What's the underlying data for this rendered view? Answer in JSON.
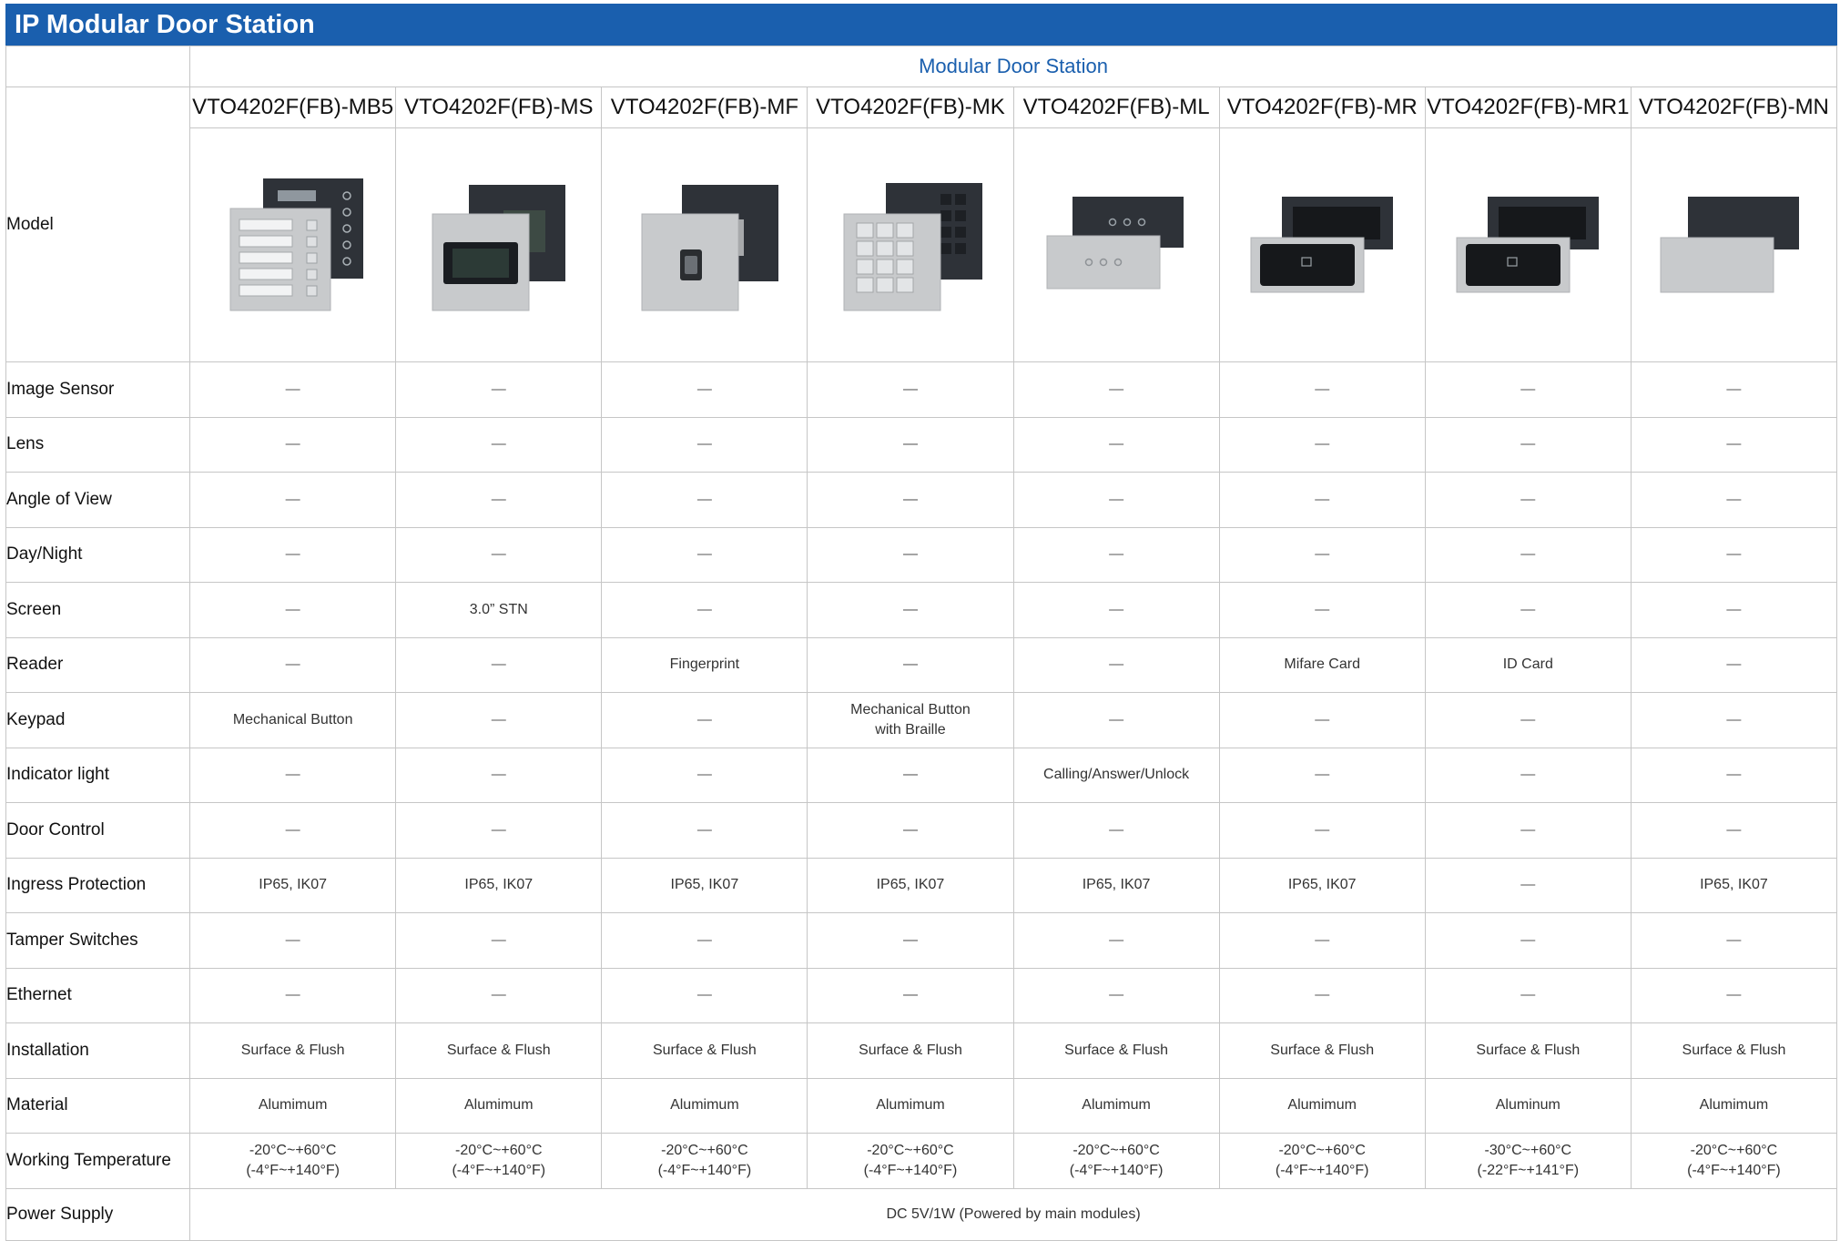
{
  "page_title": "IP Modular Door Station",
  "group_header": "Modular Door Station",
  "model_label": "Model",
  "models": [
    {
      "name": "VTO4202F(FB)-MB5",
      "image": "button-module-device-icon"
    },
    {
      "name": "VTO4202F(FB)-MS",
      "image": "screen-module-device-icon"
    },
    {
      "name": "VTO4202F(FB)-MF",
      "image": "fingerprint-module-device-icon"
    },
    {
      "name": "VTO4202F(FB)-MK",
      "image": "keypad-module-device-icon"
    },
    {
      "name": "VTO4202F(FB)-ML",
      "image": "indicator-module-device-icon"
    },
    {
      "name": "VTO4202F(FB)-MR",
      "image": "card-reader-module-device-icon"
    },
    {
      "name": "VTO4202F(FB)-MR1",
      "image": "id-card-reader-module-device-icon"
    },
    {
      "name": "VTO4202F(FB)-MN",
      "image": "blank-module-device-icon"
    }
  ],
  "rows": [
    {
      "label": "Image Sensor",
      "values": [
        "—",
        "—",
        "—",
        "—",
        "—",
        "—",
        "—",
        "—"
      ]
    },
    {
      "label": "Lens",
      "values": [
        "—",
        "—",
        "—",
        "—",
        "—",
        "—",
        "—",
        "—"
      ]
    },
    {
      "label": "Angle of View",
      "values": [
        "—",
        "—",
        "—",
        "—",
        "—",
        "—",
        "—",
        "—"
      ]
    },
    {
      "label": "Day/Night",
      "values": [
        "—",
        "—",
        "—",
        "—",
        "—",
        "—",
        "—",
        "—"
      ]
    },
    {
      "label": "Screen",
      "values": [
        "—",
        "3.0” STN",
        "—",
        "—",
        "—",
        "—",
        "—",
        "—"
      ]
    },
    {
      "label": "Reader",
      "values": [
        "—",
        "—",
        "Fingerprint",
        "—",
        "—",
        "Mifare Card",
        "ID Card",
        "—"
      ]
    },
    {
      "label": "Keypad",
      "values": [
        "Mechanical Button",
        "—",
        "—",
        "Mechanical Button\nwith Braille",
        "—",
        "—",
        "—",
        "—"
      ]
    },
    {
      "label": "Indicator light",
      "values": [
        "—",
        "—",
        "—",
        "—",
        "Calling/Answer/Unlock",
        "—",
        "—",
        "—"
      ]
    },
    {
      "label": "Door Control",
      "values": [
        "—",
        "—",
        "—",
        "—",
        "—",
        "—",
        "—",
        "—"
      ]
    },
    {
      "label": "Ingress Protection",
      "values": [
        "IP65, IK07",
        "IP65, IK07",
        "IP65, IK07",
        "IP65, IK07",
        "IP65, IK07",
        "IP65, IK07",
        "—",
        "IP65, IK07"
      ]
    },
    {
      "label": "Tamper Switches",
      "values": [
        "—",
        "—",
        "—",
        "—",
        "—",
        "—",
        "—",
        "—"
      ]
    },
    {
      "label": "Ethernet",
      "values": [
        "—",
        "—",
        "—",
        "—",
        "—",
        "—",
        "—",
        "—"
      ]
    },
    {
      "label": "Installation",
      "values": [
        "Surface & Flush",
        "Surface & Flush",
        "Surface & Flush",
        "Surface & Flush",
        "Surface & Flush",
        "Surface & Flush",
        "Surface & Flush",
        "Surface & Flush"
      ]
    },
    {
      "label": "Material",
      "values": [
        "Alumimum",
        "Alumimum",
        "Alumimum",
        "Alumimum",
        "Alumimum",
        "Alumimum",
        "Aluminum",
        "Alumimum"
      ]
    },
    {
      "label": "Working Temperature",
      "values": [
        "-20°C~+60°C\n(-4°F~+140°F)",
        "-20°C~+60°C\n(-4°F~+140°F)",
        "-20°C~+60°C\n(-4°F~+140°F)",
        "-20°C~+60°C\n(-4°F~+140°F)",
        "-20°C~+60°C\n(-4°F~+140°F)",
        "-20°C~+60°C\n(-4°F~+140°F)",
        "-30°C~+60°C\n(-22°F~+141°F)",
        "-20°C~+60°C\n(-4°F~+140°F)"
      ]
    }
  ],
  "power_supply": {
    "label": "Power Supply",
    "value": "DC 5V/1W (Powered by main modules)"
  },
  "colors": {
    "header_blue": "#1a5fae",
    "border": "#c6c6c6",
    "panel_dark": "#2e3238",
    "panel_silver": "#c4c6c8"
  }
}
